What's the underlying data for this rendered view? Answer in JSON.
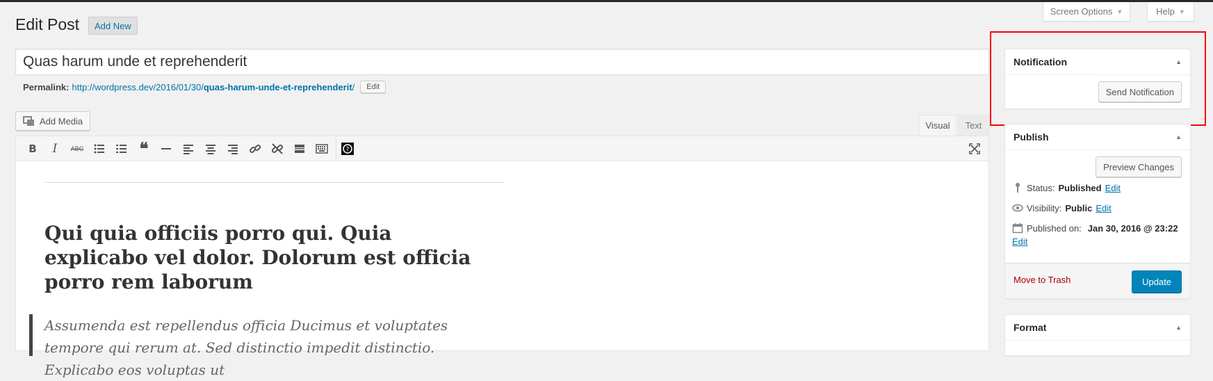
{
  "header": {
    "screen_options": "Screen Options",
    "help": "Help",
    "page_title": "Edit Post",
    "add_new": "Add New"
  },
  "post": {
    "title": "Quas harum unde et reprehenderit",
    "permalink_label": "Permalink:",
    "permalink_base": "http://wordpress.dev/2016/01/30/",
    "permalink_slug": "quas-harum-unde-et-reprehenderit",
    "permalink_end": "/",
    "permalink_edit": "Edit"
  },
  "editor": {
    "add_media": "Add Media",
    "tab_visual": "Visual",
    "tab_text": "Text",
    "heading": "Qui quia officiis porro qui. Quia explicabo vel dolor. Dolorum est officia porro rem laborum",
    "quote": "Assumenda est repellendus officia Ducimus et voluptates tempore qui rerum at. Sed distinctio impedit distinctio. Explicabo eos voluptas ut"
  },
  "toolbar": {
    "buttons": [
      "bold-icon",
      "italic-icon",
      "strikethrough-icon",
      "bullet-list-icon",
      "numbered-list-icon",
      "blockquote-icon",
      "horizontal-line-icon",
      "align-left-icon",
      "align-center-icon",
      "align-right-icon",
      "link-icon",
      "unlink-icon",
      "read-more-icon",
      "toolbar-toggle-icon",
      "plugin-icon",
      "fullscreen-icon"
    ]
  },
  "sidebar": {
    "notification": {
      "title": "Notification",
      "send_button": "Send Notification"
    },
    "publish": {
      "title": "Publish",
      "preview_button": "Preview Changes",
      "status_label": "Status:",
      "status_value": "Published",
      "visibility_label": "Visibility:",
      "visibility_value": "Public",
      "published_label": "Published on:",
      "published_value": "Jan 30, 2016 @ 23:22",
      "edit_link": "Edit",
      "trash": "Move to Trash",
      "update_button": "Update"
    },
    "format": {
      "title": "Format"
    }
  },
  "colors": {
    "accent": "#0073aa",
    "primary_button": "#0085ba",
    "highlight_box": "#ff0000",
    "trash": "#a00000"
  }
}
